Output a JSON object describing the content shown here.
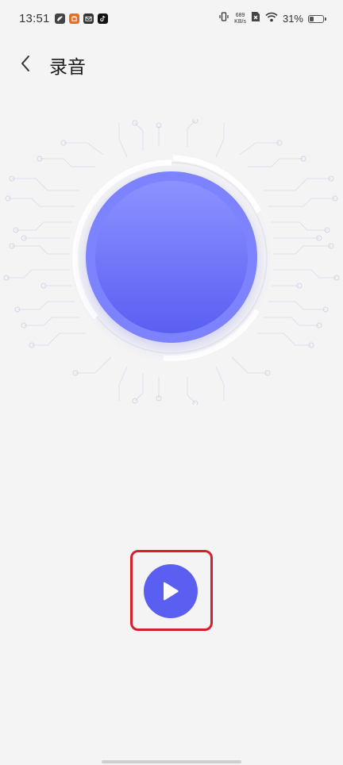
{
  "status_bar": {
    "time": "13:51",
    "net_speed_value": "689",
    "net_speed_unit": "KB/s",
    "battery_percent": "31%",
    "battery_level": 0.31,
    "icons": [
      "app-notification-icon",
      "shopping-app-icon",
      "mail-icon",
      "tiktok-icon",
      "vibrate-icon",
      "no-sim-icon",
      "wifi-icon",
      "battery-icon"
    ]
  },
  "header": {
    "title": "录音",
    "back_icon": "chevron-left-icon"
  },
  "recorder": {
    "orb_icon": "record-orb",
    "play_icon": "play-icon"
  },
  "colors": {
    "accent": "#5a5ff2",
    "orb_outer": "#7d83ff",
    "highlight": "#d61f2c",
    "background": "#f4f4f4"
  }
}
